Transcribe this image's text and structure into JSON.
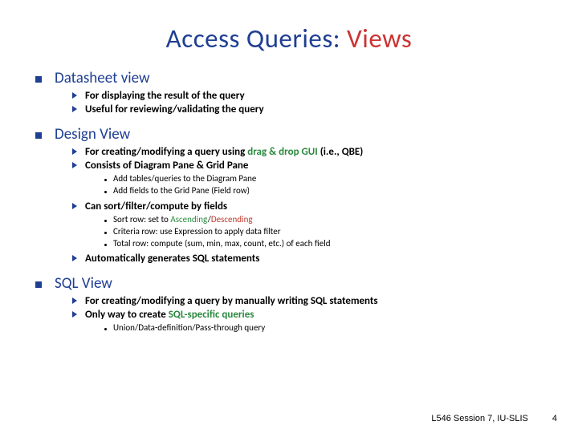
{
  "title": {
    "main": "Access Queries:",
    "sub": "Views"
  },
  "sections": [
    {
      "label": "Datasheet view",
      "items": [
        {
          "text": "For displaying the result of the query"
        },
        {
          "text": "Useful for reviewing/validating the query"
        }
      ]
    },
    {
      "label": "Design View",
      "items": [
        {
          "text_pre": "For creating/modifying a query using ",
          "green": "drag & drop GUI",
          "text_post": " (i.e., QBE)"
        },
        {
          "text": "Consists of Diagram Pane & Grid Pane",
          "sub": [
            "Add tables/queries to the Diagram Pane",
            "Add fields to the Grid Pane (Field row)"
          ]
        },
        {
          "text": "Can sort/filter/compute by fields",
          "sub_rich": [
            {
              "pre": "Sort row: set to ",
              "green": "Ascending",
              "mid": "/",
              "red": "Descending",
              "post": ""
            },
            {
              "pre": "Criteria row: use Expression to apply data filter"
            },
            {
              "pre": "Total row: compute (sum, min, max, count, etc.) of each field"
            }
          ]
        },
        {
          "text": "Automatically generates SQL statements"
        }
      ]
    },
    {
      "label": "SQL View",
      "items": [
        {
          "text": "For creating/modifying a query by manually writing SQL statements"
        },
        {
          "text_pre": "Only way to create ",
          "green": "SQL-specific queries",
          "sub": [
            "Union/Data-definition/Pass-through query"
          ]
        }
      ]
    }
  ],
  "footer": {
    "source": "L546 Session 7, IU-SLIS",
    "page": "4"
  }
}
